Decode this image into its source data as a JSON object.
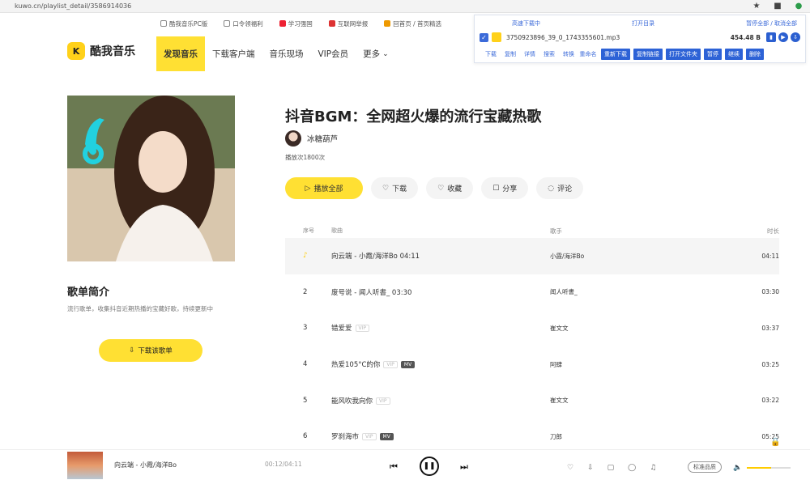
{
  "browser": {
    "url": "kuwo.cn/playlist_detail/3586914036",
    "icons": [
      "star-icon",
      "extension-icon",
      "profile-icon"
    ]
  },
  "util_links": [
    "酷我音乐PC版",
    "口令领福利",
    "学习强国",
    "互联网举报",
    "回首页 / 首页精选"
  ],
  "logo": {
    "text": "酷我音乐",
    "mark": "K"
  },
  "nav": {
    "items": [
      {
        "label": "发现音乐",
        "active": true
      },
      {
        "label": "下载客户端",
        "active": false
      },
      {
        "label": "音乐现场",
        "active": false
      },
      {
        "label": "VIP会员",
        "active": false
      },
      {
        "label": "更多",
        "active": false
      }
    ]
  },
  "download_panel": {
    "header": [
      "高速下载中",
      "打开目录",
      "暂停全部 / 取消全部"
    ],
    "file_name": "3750923896_39_0_1743355601.mp3",
    "file_size": "454.48 B",
    "links": [
      "下载",
      "复制",
      "详情",
      "搜索",
      "转换",
      "重命名"
    ],
    "buttons": [
      "重新下载",
      "复制链接",
      "打开文件夹",
      "暂停",
      "继续",
      "删除"
    ]
  },
  "playlist": {
    "title": "抖音BGM：全网超火爆的流行宝藏热歌",
    "creator": "冰糖葫芦",
    "play_count": "播放次1800次",
    "intro_title": "歌单简介",
    "intro_text": "流行歌单，收集抖音近期热播的宝藏好歌，持续更新中",
    "download_playlist_label": "下载该歌单",
    "actions": [
      "播放全部",
      "下载",
      "收藏",
      "分享",
      "评论"
    ]
  },
  "table": {
    "headers": {
      "index": "序号",
      "song": "歌曲",
      "artist": "歌手",
      "duration": "时长"
    },
    "rows": [
      {
        "index": "",
        "song": "向云端 - 小霞/海洋Bo 04:11",
        "artist": "小霞/海洋Bo",
        "duration": "04:11",
        "playing": true,
        "tags": []
      },
      {
        "index": "2",
        "song": "废号说 - 闻人听書_ 03:30",
        "artist": "闻人听書_",
        "duration": "03:30",
        "playing": false,
        "tags": []
      },
      {
        "index": "3",
        "song": "错爱爱",
        "artist": "崔文文",
        "duration": "03:37",
        "playing": false,
        "tags": [
          "VIP"
        ]
      },
      {
        "index": "4",
        "song": "热爱105°C的你",
        "artist": "阿肆",
        "duration": "03:25",
        "playing": false,
        "tags": [
          "VIP",
          "MV"
        ]
      },
      {
        "index": "5",
        "song": "能风吹我向你",
        "artist": "崔文文",
        "duration": "03:22",
        "playing": false,
        "tags": [
          "VIP"
        ]
      },
      {
        "index": "6",
        "song": "罗刹海市",
        "artist": "刀郎",
        "duration": "05:25",
        "playing": false,
        "tags": [
          "VIP",
          "MV"
        ]
      }
    ]
  },
  "player": {
    "title": "向云端 - 小霞/海洋Bo",
    "time": "00:12/04:11",
    "quality": "标准品质",
    "volume": 0.55,
    "icons": [
      "heart-icon",
      "download-icon",
      "comment-icon",
      "share-icon",
      "playlist-icon"
    ]
  }
}
